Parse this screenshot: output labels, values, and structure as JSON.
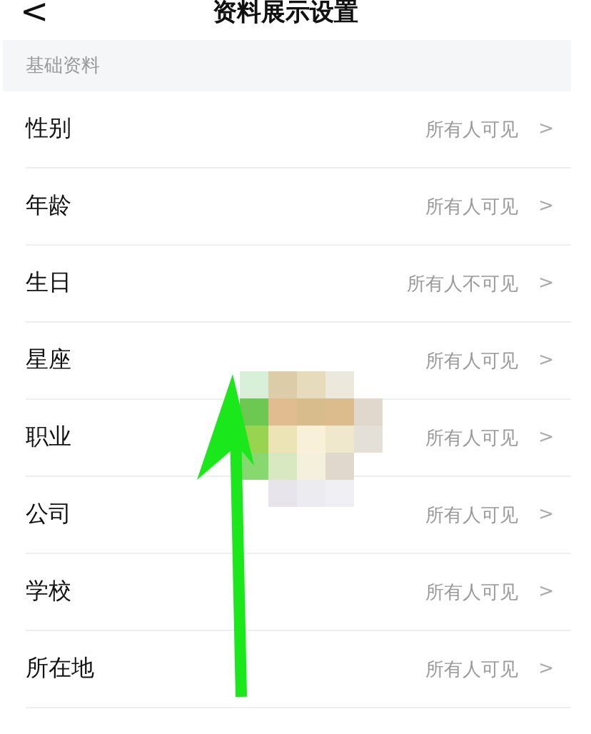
{
  "header": {
    "back": "<",
    "title": "资料展示设置"
  },
  "section": {
    "title": "基础资料"
  },
  "rows": [
    {
      "label": "性别",
      "value": "所有人可见",
      "chevron": ">"
    },
    {
      "label": "年龄",
      "value": "所有人可见",
      "chevron": ">"
    },
    {
      "label": "生日",
      "value": "所有人不可见",
      "chevron": ">"
    },
    {
      "label": "星座",
      "value": "所有人可见",
      "chevron": ">"
    },
    {
      "label": "职业",
      "value": "所有人可见",
      "chevron": ">"
    },
    {
      "label": "公司",
      "value": "所有人可见",
      "chevron": ">"
    },
    {
      "label": "学校",
      "value": "所有人可见",
      "chevron": ">"
    },
    {
      "label": "所在地",
      "value": "所有人可见",
      "chevron": ">"
    }
  ]
}
